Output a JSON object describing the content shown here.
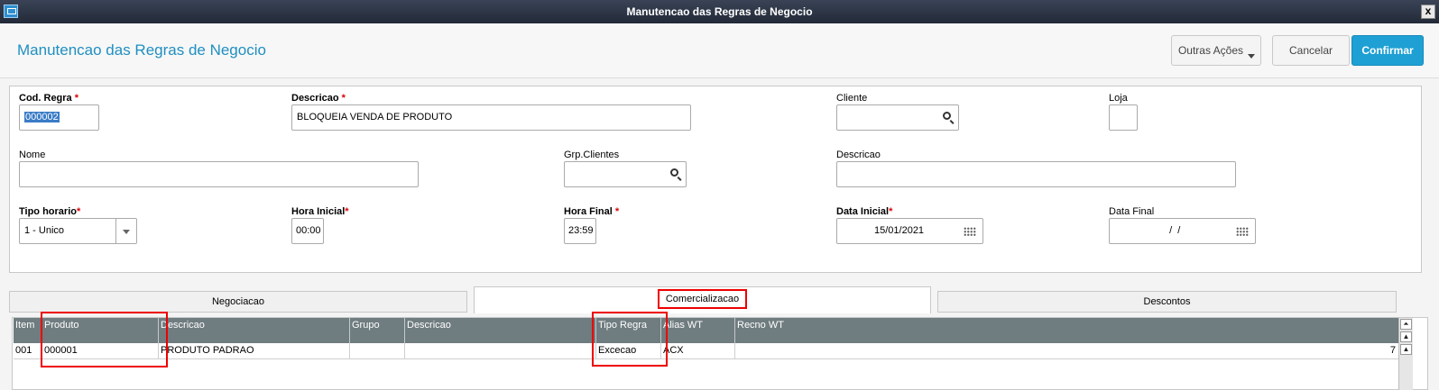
{
  "window": {
    "title": "Manutencao das Regras de Negocio",
    "close_symbol": "x"
  },
  "header": {
    "title": "Manutencao das Regras de Negocio",
    "buttons": {
      "outras": "Outras Ações",
      "cancelar": "Cancelar",
      "confirmar": "Confirmar"
    },
    "accent_color": "#1ea0d4"
  },
  "form": {
    "cod_regra": {
      "label": "Cod. Regra",
      "required": "*",
      "value": "000002"
    },
    "descricao": {
      "label": "Descricao",
      "required": "*",
      "value": "BLOQUEIA VENDA DE PRODUTO"
    },
    "cliente": {
      "label": "Cliente",
      "value": ""
    },
    "loja": {
      "label": "Loja",
      "value": ""
    },
    "nome": {
      "label": "Nome",
      "value": ""
    },
    "grp_clientes": {
      "label": "Grp.Clientes",
      "value": ""
    },
    "descricao2": {
      "label": "Descricao",
      "value": ""
    },
    "tipo_horario": {
      "label": "Tipo horario",
      "required": "*",
      "value": "1 - Unico"
    },
    "hora_inicial": {
      "label": "Hora Inicial",
      "required": "*",
      "value": "00:00"
    },
    "hora_final": {
      "label": "Hora Final",
      "required": "*",
      "value": "23:59"
    },
    "data_inicial": {
      "label": "Data Inicial",
      "required": "*",
      "value": "15/01/2021"
    },
    "data_final": {
      "label": "Data Final",
      "value": "  /  /"
    }
  },
  "tabs": [
    {
      "label": "Negociacao",
      "active": false
    },
    {
      "label": "Comercializacao",
      "active": true
    },
    {
      "label": "Descontos",
      "active": false
    }
  ],
  "grid": {
    "columns": [
      "Item",
      "Produto",
      "Descricao",
      "Grupo",
      "Descricao",
      "Tipo Regra",
      "Alias WT",
      "Recno WT"
    ],
    "rows": [
      [
        "001",
        "000001",
        "PRODUTO PADRAO",
        "",
        "",
        "Excecao",
        "ACX",
        "7"
      ]
    ]
  },
  "scrollbar": {
    "top": "⏶",
    "up": "▲"
  }
}
